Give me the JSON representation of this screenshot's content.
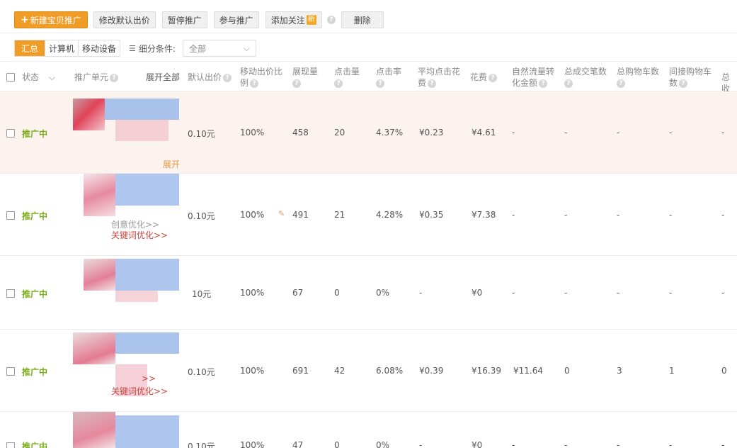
{
  "toolbar": {
    "new_button": "新建宝贝推广",
    "modify_bid": "修改默认出价",
    "pause": "暂停推广",
    "join": "参与推广",
    "follow": "添加关注",
    "follow_badge": "新",
    "delete": "删除"
  },
  "filter": {
    "tabs": [
      "汇总",
      "计算机",
      "移动设备"
    ],
    "active_tab": "汇总",
    "condition_label": "细分条件:",
    "condition_value": "全部"
  },
  "table": {
    "headers": {
      "status": "状态",
      "unit": "推广单元",
      "expand_all": "展开全部",
      "default_bid": "默认出价",
      "mobile_ratio_1": "移动出价比",
      "mobile_ratio_2": "例",
      "impressions": "展现量",
      "clicks": "点击量",
      "ctr": "点击率",
      "avg_cpc_1": "平均点击花",
      "avg_cpc_2": "费",
      "cost": "花费",
      "natural_1": "自然流量转",
      "natural_2": "化金额",
      "deals": "总成交笔数",
      "cart": "总购物车数",
      "indirect_cart_1": "间接购物车",
      "indirect_cart_2": "数",
      "total": "总收"
    },
    "rows": [
      {
        "status": "推广中",
        "bid": "0.10元",
        "ratio": "100%",
        "impressions": "458",
        "clicks": "20",
        "ctr": "4.37%",
        "cpc": "¥0.23",
        "cost": "¥4.61",
        "natural": "-",
        "deals": "-",
        "cart": "-",
        "indirect": "-",
        "total": "-",
        "link1": "",
        "link2": "展开"
      },
      {
        "status": "推广中",
        "bid": "0.10元",
        "ratio": "100%",
        "impressions": "491",
        "clicks": "21",
        "ctr": "4.28%",
        "cpc": "¥0.35",
        "cost": "¥7.38",
        "natural": "-",
        "deals": "-",
        "cart": "-",
        "indirect": "-",
        "total": "-",
        "link1": "创意优化>>",
        "link2": "关键词优化>>"
      },
      {
        "status": "推广中",
        "bid": "10元",
        "ratio": "100%",
        "impressions": "67",
        "clicks": "0",
        "ctr": "0%",
        "cpc": "-",
        "cost": "¥0",
        "natural": "-",
        "deals": "-",
        "cart": "-",
        "indirect": "-",
        "total": "-",
        "link1": "",
        "link2": ""
      },
      {
        "status": "推广中",
        "bid": "0.10元",
        "ratio": "100%",
        "impressions": "691",
        "clicks": "42",
        "ctr": "6.08%",
        "cpc": "¥0.39",
        "cost": "¥16.39",
        "natural": "¥11.64",
        "deals": "0",
        "cart": "3",
        "indirect": "1",
        "total": "0",
        "link1": ">>",
        "link2": "关键词优化>>"
      },
      {
        "status": "推广中",
        "bid": "0.10元",
        "ratio": "100%",
        "impressions": "47",
        "clicks": "0",
        "ctr": "0%",
        "cpc": "-",
        "cost": "¥0",
        "natural": "-",
        "deals": "-",
        "cart": "-",
        "indirect": "-",
        "total": "-",
        "link1": "",
        "link2": ""
      }
    ]
  },
  "colors": {
    "accent": "#f09d28",
    "status_green": "#7cab1c",
    "link_red": "#c8463e",
    "highlight_row": "#fcf3ee"
  }
}
